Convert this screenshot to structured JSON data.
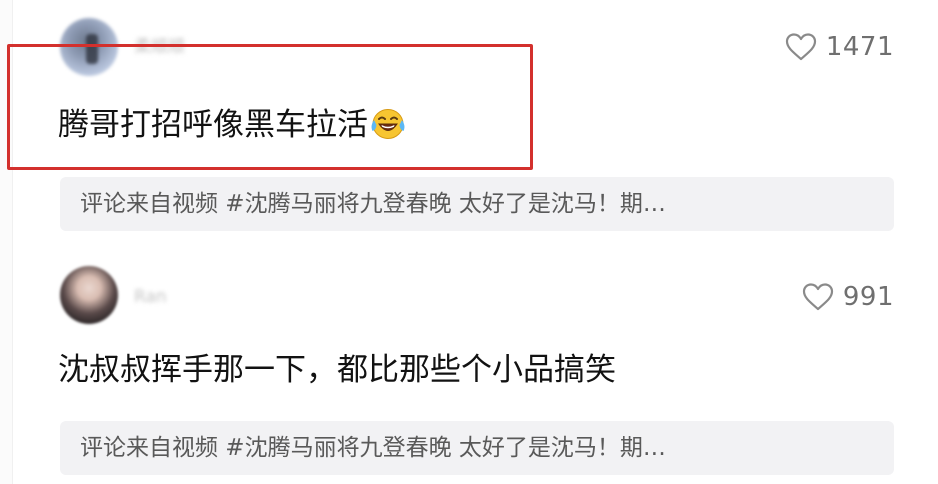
{
  "comments": [
    {
      "username": "柔顺顺",
      "likes": "1471",
      "text": "腾哥打招呼像黑车拉活",
      "emoji": "laughing-tears-emoji",
      "source": "评论来自视频 #沈腾马丽将九登春晚 太好了是沈马！期…"
    },
    {
      "username": "Ran",
      "likes": "991",
      "text": "沈叔叔挥手那一下，都比那些个小品搞笑",
      "source": "评论来自视频 #沈腾马丽将九登春晚 太好了是沈马！期…"
    }
  ],
  "icons": {
    "like": "heart-outline-icon"
  },
  "colors": {
    "highlight": "#d3302d",
    "chip_bg": "#f2f2f4",
    "like_text": "#6f6f6f"
  }
}
